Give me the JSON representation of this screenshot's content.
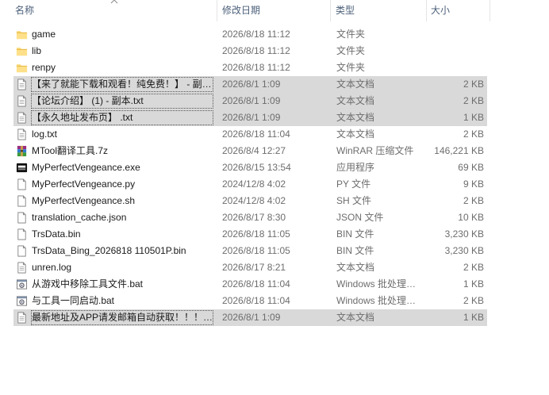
{
  "columns": {
    "name": "名称",
    "date": "修改日期",
    "type": "类型",
    "size": "大小"
  },
  "rows": [
    {
      "name": "game",
      "date": "2026/8/18 11:12",
      "type": "文件夹",
      "size": "",
      "icon": "folder-icon",
      "selected": false
    },
    {
      "name": "lib",
      "date": "2026/8/18 11:12",
      "type": "文件夹",
      "size": "",
      "icon": "folder-icon",
      "selected": false
    },
    {
      "name": "renpy",
      "date": "2026/8/18 11:12",
      "type": "文件夹",
      "size": "",
      "icon": "folder-icon",
      "selected": false
    },
    {
      "name": "【来了就能下载和观看！纯免费！】 - 副…",
      "date": "2026/8/1 1:09",
      "type": "文本文档",
      "size": "2 KB",
      "icon": "text-file-icon",
      "selected": true
    },
    {
      "name": "【论坛介绍】 (1) - 副本.txt",
      "date": "2026/8/1 1:09",
      "type": "文本文档",
      "size": "2 KB",
      "icon": "text-file-icon",
      "selected": true
    },
    {
      "name": "【永久地址发布页】 .txt",
      "date": "2026/8/1 1:09",
      "type": "文本文档",
      "size": "1 KB",
      "icon": "text-file-icon",
      "selected": true
    },
    {
      "name": "log.txt",
      "date": "2026/8/18 11:04",
      "type": "文本文档",
      "size": "2 KB",
      "icon": "text-file-icon",
      "selected": false
    },
    {
      "name": "MTool翻译工具.7z",
      "date": "2026/8/4 12:27",
      "type": "WinRAR 压缩文件",
      "size": "146,221 KB",
      "icon": "winrar-archive-icon",
      "selected": false
    },
    {
      "name": "MyPerfectVengeance.exe",
      "date": "2026/8/15 13:54",
      "type": "应用程序",
      "size": "69 KB",
      "icon": "app-exe-icon",
      "selected": false
    },
    {
      "name": "MyPerfectVengeance.py",
      "date": "2024/12/8 4:02",
      "type": "PY 文件",
      "size": "9 KB",
      "icon": "generic-file-icon",
      "selected": false
    },
    {
      "name": "MyPerfectVengeance.sh",
      "date": "2024/12/8 4:02",
      "type": "SH 文件",
      "size": "2 KB",
      "icon": "generic-file-icon",
      "selected": false
    },
    {
      "name": "translation_cache.json",
      "date": "2026/8/17 8:30",
      "type": "JSON 文件",
      "size": "10 KB",
      "icon": "generic-file-icon",
      "selected": false
    },
    {
      "name": "TrsData.bin",
      "date": "2026/8/18 11:05",
      "type": "BIN 文件",
      "size": "3,230 KB",
      "icon": "generic-file-icon",
      "selected": false
    },
    {
      "name": "TrsData_Bing_2026818 110501P.bin",
      "date": "2026/8/18 11:05",
      "type": "BIN 文件",
      "size": "3,230 KB",
      "icon": "generic-file-icon",
      "selected": false
    },
    {
      "name": "unren.log",
      "date": "2026/8/17 8:21",
      "type": "文本文档",
      "size": "2 KB",
      "icon": "text-file-icon",
      "selected": false
    },
    {
      "name": "从游戏中移除工具文件.bat",
      "date": "2026/8/18 11:04",
      "type": "Windows 批处理…",
      "size": "1 KB",
      "icon": "batch-file-icon",
      "selected": false
    },
    {
      "name": "与工具一同启动.bat",
      "date": "2026/8/18 11:04",
      "type": "Windows 批处理…",
      "size": "2 KB",
      "icon": "batch-file-icon",
      "selected": false
    },
    {
      "name": "最新地址及APP请发邮箱自动获取！！！…",
      "date": "2026/8/1 1:09",
      "type": "文本文档",
      "size": "1 KB",
      "icon": "text-file-icon",
      "selected": true
    }
  ]
}
